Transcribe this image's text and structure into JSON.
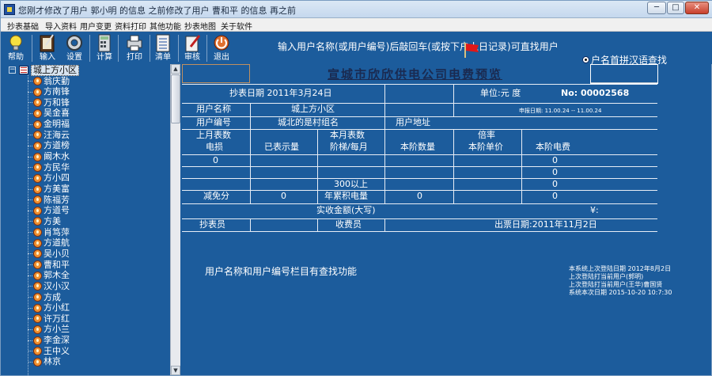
{
  "window": {
    "title": "您刚才修改了用户 郭小明 的信息 之前修改了用户 曹和平 的信息 再之前",
    "minimize": "─",
    "maximize": "□",
    "close": "✕"
  },
  "menu": [
    "抄表基础",
    "导入资料",
    "用户变更",
    "资料打印",
    "其他功能",
    "抄表地图",
    "关于软件"
  ],
  "toolbar": {
    "buttons": [
      {
        "label": "帮助",
        "icon": "lightbulb-icon"
      },
      {
        "label": "输入",
        "icon": "notebook-pen-icon"
      },
      {
        "label": "设置",
        "icon": "gear-icon"
      },
      {
        "label": "计算",
        "icon": "calculator-icon"
      },
      {
        "label": "打印",
        "icon": "printer-icon"
      },
      {
        "label": "清单",
        "icon": "list-icon"
      },
      {
        "label": "审核",
        "icon": "edit-icon"
      },
      {
        "label": "退出",
        "icon": "exit-icon"
      }
    ],
    "search_hint": "输入用户名称(或用户编号)后敲回车(或按下户上日记录)可直找用户",
    "pinyin_option": "户名首拼汉语查找"
  },
  "tree": {
    "root": "城上方小区",
    "items": [
      "翁庆勤",
      "方南锋",
      "万和锋",
      "吴金喜",
      "金明福",
      "汪海云",
      "方道榜",
      "阚木水",
      "方民华",
      "方小四",
      "方美富",
      "陈福芳",
      "方道号",
      "方美",
      "肖笃萍",
      "方道航",
      "吴小贝",
      "曹和平",
      "郭木全",
      "汉小汉",
      "方成",
      "方小红",
      "许万红",
      "方小兰",
      "李金深",
      "王中义",
      "林京"
    ]
  },
  "report": {
    "title": "宣城市欣欣供电公司电费预览",
    "meter_date": "抄表日期 2011年3月24日",
    "unit_label": "单位:元 度",
    "no_label": "No: 00002568",
    "period_small": "申报日期: 11.00.24 -- 11.00.24",
    "user_name_label": "用户名称",
    "user_name_value": "城上方小区",
    "user_no_label": "用户编号",
    "user_no_value": "城北的是村组名",
    "addr_label": "用户地址",
    "hdr_c1a": "上月表数",
    "hdr_c1b": "电损",
    "hdr_c2": "已表示量",
    "hdr_c3a": "本月表数",
    "hdr_c3b": "阶梯/每月",
    "hdr_c4": "本阶数量",
    "hdr_c5a": "倍率",
    "hdr_c5b": "本阶单价",
    "hdr_c6": "本阶电费",
    "r1_c1": "0",
    "r1_c6": "0",
    "r2_c6": "0",
    "r3_c3": "300以上",
    "r3_c6": "0",
    "r4_c1": "减免分",
    "r4_c2": "0",
    "r4_c3": "年累积电量",
    "r4_c4": "0",
    "r4_c6": "0",
    "total_label": "实收金额(大写)",
    "yuan": "¥:",
    "meter_reader": "抄表员",
    "receiver": "收费员",
    "print_date": "出票日期:2011年11月2日"
  },
  "bottom": {
    "hint": "用户名称和用户编号栏目有查找功能",
    "sysinfo": [
      "本系统上次登陆日期 2012年8月2日",
      "上次登陆打当前用户(郭明)",
      "上次登陆打当前用户(王华)曹国贤",
      "系统本次日期 2015-10-20 10:7:30"
    ]
  }
}
